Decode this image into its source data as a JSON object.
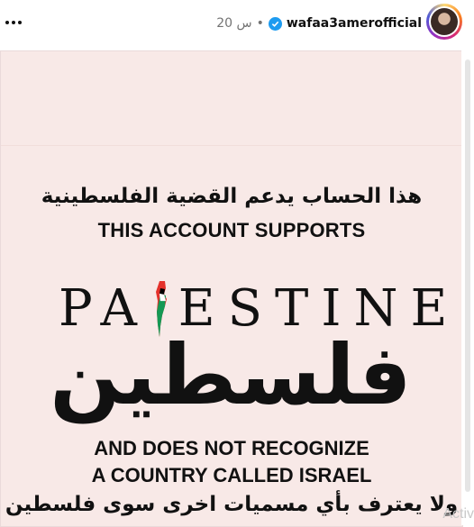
{
  "header": {
    "username": "wafaa3amerofficial",
    "separator": "•",
    "time": "20 س",
    "verified_icon": "verified-badge-icon",
    "more_icon": "more-options-icon"
  },
  "post": {
    "arabic_line_1": "هذا الحساب يدعم القضية الفلسطينية",
    "english_line_1": "THIS ACCOUNT SUPPORTS",
    "palestine_word": "PA ESTINE",
    "arabic_calligraphy": "فلسطين",
    "english_line_2": "AND DOES NOT RECOGNIZE",
    "english_line_3": "A COUNTRY CALLED ISRAEL",
    "arabic_line_2": "ولا يعترف بأي مسميات اخرى سوى فلسطين",
    "flag_colors": {
      "black": "#000000",
      "white": "#ffffff",
      "green": "#149954",
      "red": "#e4312b"
    },
    "background_color": "#f8e9e7"
  },
  "overlay": {
    "watermark_text": "Activ"
  }
}
